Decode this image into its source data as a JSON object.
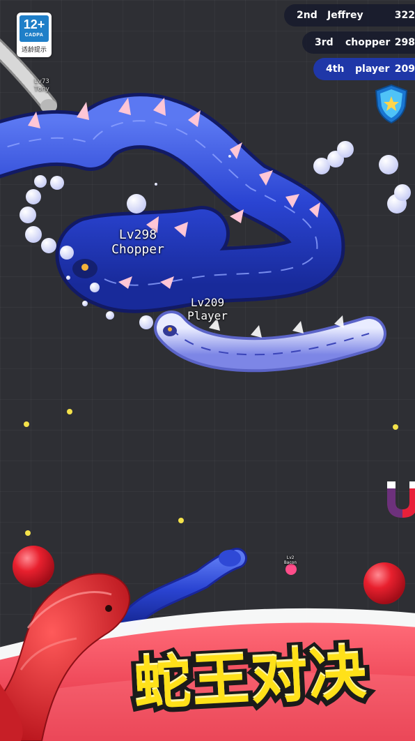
{
  "badge": {
    "age": "12+",
    "org": "CADPA",
    "tip": "适龄提示"
  },
  "leaderboard": [
    {
      "rank": "2nd",
      "name": "Jeffrey",
      "score": "322"
    },
    {
      "rank": "3rd",
      "name": "chopper",
      "score": "298"
    },
    {
      "rank": "4th",
      "name": "player",
      "score": "209"
    }
  ],
  "players": {
    "chopper": {
      "level": "Lv298",
      "name": "Chopper"
    },
    "player": {
      "level": "Lv209",
      "name": "Player"
    },
    "tony": {
      "level": "Lv73",
      "name": "Tony"
    },
    "small": {
      "level": "Lv2",
      "name": "Bacon"
    }
  },
  "title": "蛇王对决",
  "icons": [
    "shield-star-icon",
    "magnet-icon"
  ],
  "colors": {
    "background": "#2e2f34",
    "snake_blue": "#2f49d6",
    "title_yellow": "#ffe119",
    "banner_red": "#e83c4c"
  }
}
